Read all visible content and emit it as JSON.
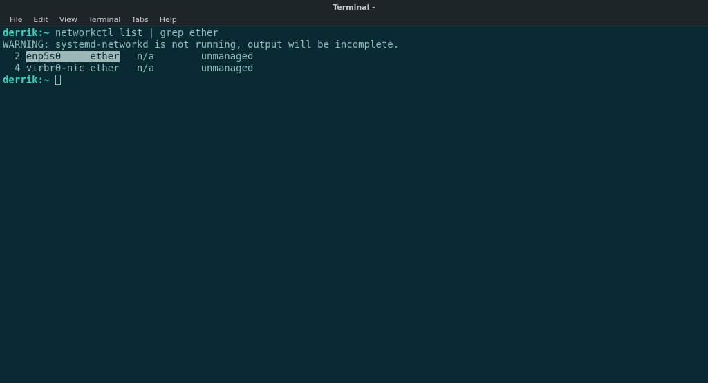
{
  "titlebar": {
    "title": "Terminal -"
  },
  "menubar": {
    "items": [
      "File",
      "Edit",
      "View",
      "Terminal",
      "Tabs",
      "Help"
    ]
  },
  "terminal": {
    "prompt1_user": "derrik",
    "prompt1_sep": ":",
    "prompt1_path": "~",
    "command1": " networkctl list | grep ether",
    "warning": "WARNING: systemd-networkd is not running, output will be incomplete.",
    "blank": "",
    "row1_pre": "  2 ",
    "row1_highlight": "enp5s0     ether",
    "row1_post": "   n/a        unmanaged",
    "row2": "  4 virbr0-nic ether   n/a        unmanaged",
    "prompt2_user": "derrik",
    "prompt2_sep": ":",
    "prompt2_path": "~",
    "prompt2_space": " "
  }
}
